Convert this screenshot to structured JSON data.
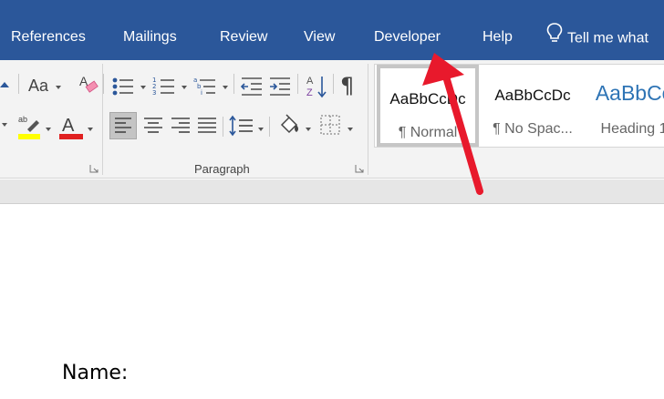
{
  "tabs": {
    "references": "References",
    "mailings": "Mailings",
    "review": "Review",
    "view": "View",
    "developer": "Developer",
    "help": "Help",
    "tell_me": "Tell me what"
  },
  "ribbon": {
    "paragraph_group_label": "Paragraph",
    "styles": [
      {
        "sample": "AaBbCcDc",
        "name": "¶ Normal"
      },
      {
        "sample": "AaBbCcDc",
        "name": "¶ No Spac..."
      },
      {
        "sample": "AaBbCc",
        "name": "Heading 1"
      }
    ],
    "change_case_label": "Aa",
    "sort_label": "AZ",
    "highlight_color": "#ffff00",
    "font_color": "#e02020"
  },
  "document": {
    "text": "Name:"
  },
  "colors": {
    "ribbon_tab_bar": "#2b579a",
    "heading_style": "#2e74b5",
    "annotation_arrow": "#e8192c"
  },
  "icons": [
    "lightbulb-icon",
    "change-case-icon",
    "clear-formatting-icon",
    "bullets-icon",
    "numbering-icon",
    "multilevel-list-icon",
    "decrease-indent-icon",
    "increase-indent-icon",
    "sort-icon",
    "show-paragraph-marks-icon",
    "text-highlight-icon",
    "font-color-icon",
    "align-left-icon",
    "center-icon",
    "align-right-icon",
    "justify-icon",
    "line-spacing-icon",
    "shading-icon",
    "borders-icon",
    "dialog-launcher-icon"
  ]
}
